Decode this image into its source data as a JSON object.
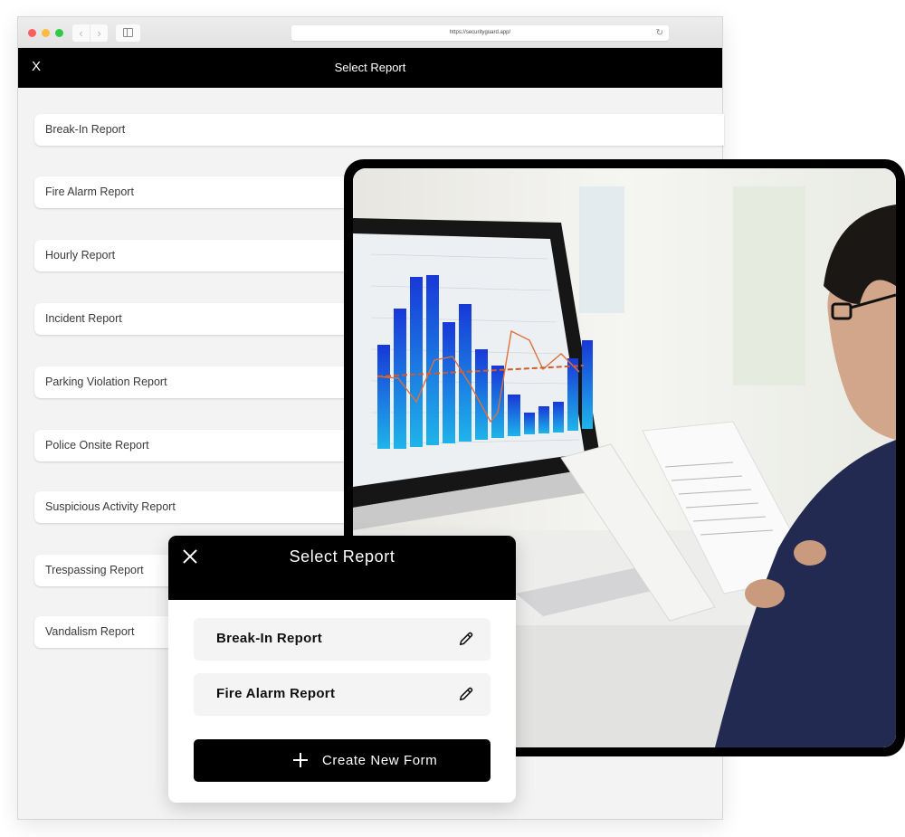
{
  "browser": {
    "url": "https://securityguard.app/",
    "back_icon": "chevron-left-icon",
    "forward_icon": "chevron-right-icon",
    "sidebar_icon": "sidebar-icon",
    "reload_icon": "reload-icon"
  },
  "app_bar": {
    "close_label": "X",
    "title": "Select Report"
  },
  "report_list": [
    {
      "label": "Break-In Report"
    },
    {
      "label": "Fire Alarm Report"
    },
    {
      "label": "Hourly Report"
    },
    {
      "label": "Incident Report"
    },
    {
      "label": "Parking Violation Report"
    },
    {
      "label": "Police Onsite Report"
    },
    {
      "label": "Suspicious Activity Report"
    },
    {
      "label": "Trespassing Report"
    },
    {
      "label": "Vandalism Report"
    }
  ],
  "photo": {
    "description": "Man in glasses and navy blazer reviewing printed reports in front of a monitor showing a bar chart"
  },
  "modal": {
    "title": "Select Report",
    "close_icon": "close-icon",
    "items": [
      {
        "label": "Break-In Report",
        "icon": "pencil-icon"
      },
      {
        "label": "Fire Alarm Report",
        "icon": "pencil-icon"
      }
    ],
    "create_button": {
      "label": "Create New Form",
      "icon": "plus-icon"
    }
  },
  "colors": {
    "header_bg": "#000000",
    "page_bg": "#f3f3f3",
    "item_bg": "#ffffff",
    "modal_item_bg": "#f4f4f4",
    "traffic_red": "#fc605c",
    "traffic_yellow": "#fdbc40",
    "traffic_green": "#34c84a",
    "chart_bar_blue": "#1a4fe0",
    "chart_line_orange": "#e0703a"
  }
}
